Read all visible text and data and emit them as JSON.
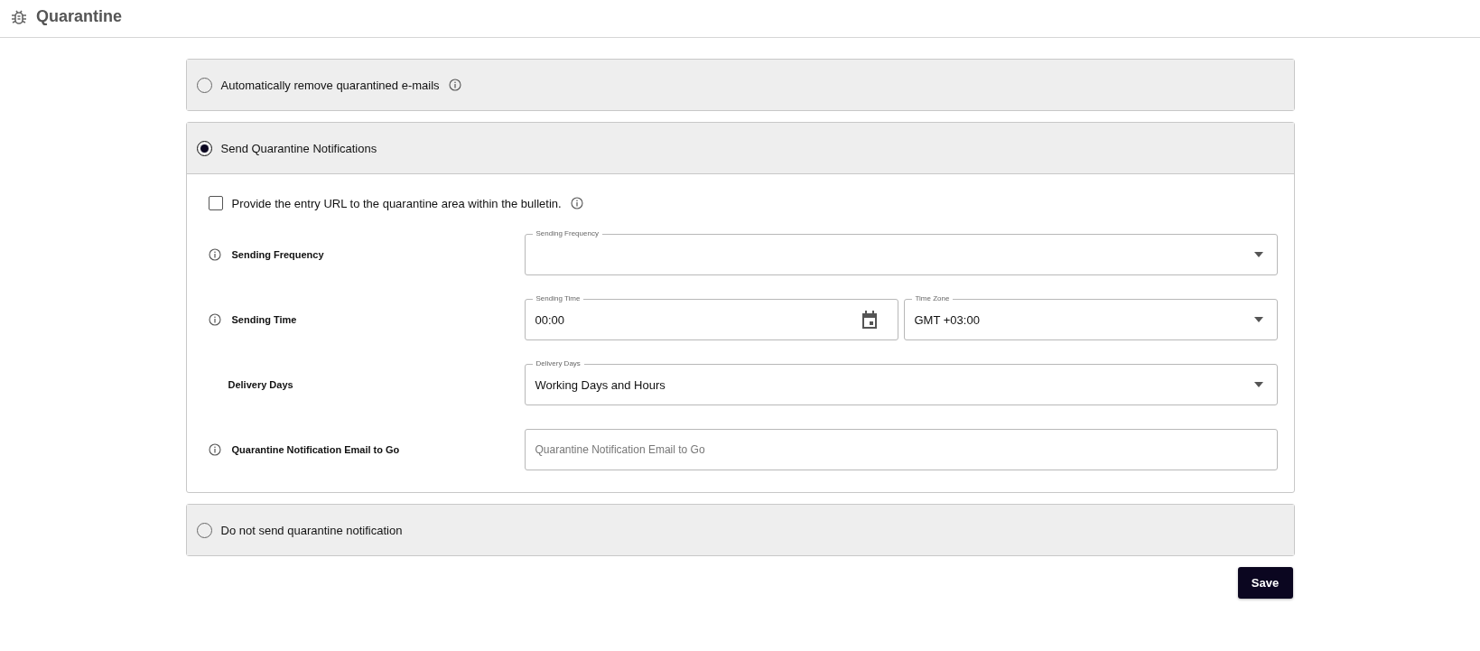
{
  "header": {
    "title": "Quarantine"
  },
  "options": [
    {
      "label": "Automatically remove quarantined e-mails",
      "selected": false,
      "info": true,
      "expanded": false
    },
    {
      "label": "Send Quarantine Notifications",
      "selected": true,
      "info": false,
      "expanded": true,
      "settings": {
        "checkbox": {
          "label": "Provide the entry URL to the quarantine area within the bulletin.",
          "checked": false,
          "info": true
        },
        "rows": [
          {
            "label": "Sending Frequency",
            "info": true,
            "fields": [
              {
                "kind": "select",
                "label": "Sending Frequency"
              }
            ]
          },
          {
            "label": "Sending Time",
            "info": true,
            "fields": [
              {
                "kind": "time",
                "label": "Sending Time",
                "value": "00:00"
              },
              {
                "kind": "select",
                "label": "Time Zone",
                "value": "GMT +03:00"
              }
            ]
          },
          {
            "label": "Delivery Days",
            "info": false,
            "fields": [
              {
                "kind": "select",
                "label": "Delivery Days",
                "value": "Working Days and Hours"
              }
            ]
          },
          {
            "label": "Quarantine Notification Email to Go",
            "info": true,
            "fields": [
              {
                "kind": "text",
                "placeholder": "Quarantine Notification Email to Go"
              }
            ]
          }
        ]
      }
    },
    {
      "label": "Do not send quarantine notification",
      "selected": false,
      "info": false,
      "expanded": false
    }
  ],
  "save_button": "Save"
}
